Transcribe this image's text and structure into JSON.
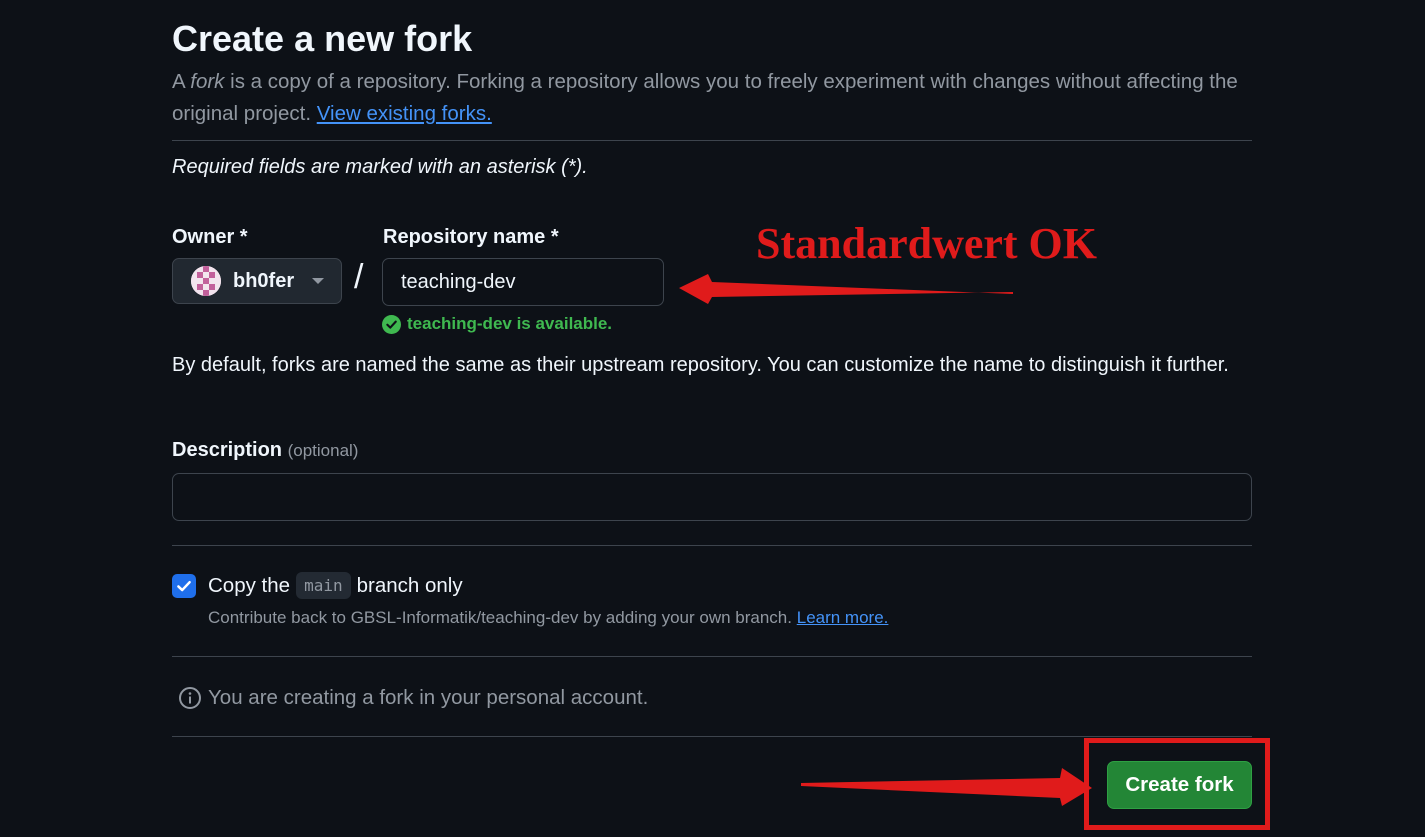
{
  "header": {
    "title": "Create a new fork",
    "subtitle_prefix": "A ",
    "subtitle_em": "fork",
    "subtitle_rest": " is a copy of a repository. Forking a repository allows you to freely experiment with changes without affecting the original project. ",
    "view_forks_link": "View existing forks."
  },
  "form": {
    "required_note": "Required fields are marked with an asterisk (*).",
    "owner_label": "Owner *",
    "owner_value": "bh0fer",
    "repo_label": "Repository name *",
    "separator": "/",
    "repo_value": "teaching-dev",
    "availability": "teaching-dev is available.",
    "naming_hint": "By default, forks are named the same as their upstream repository. You can customize the name to distinguish it further.",
    "description_label": "Description",
    "description_optional": "(optional)",
    "description_value": "",
    "copy_branch_before": "Copy the",
    "copy_branch_code": "main",
    "copy_branch_after": "branch only",
    "copy_branch_checked": true,
    "copy_hint": "Contribute back to GBSL-Informatik/teaching-dev by adding your own branch.",
    "learn_more": "Learn more.",
    "info_text": "You are creating a fork in your personal account.",
    "create_button": "Create fork"
  },
  "annotations": {
    "text": "Standardwert OK",
    "color": "#e01b1b"
  },
  "icons": {
    "owner_caret": "triangle-down-icon",
    "availability": "check-circle-icon",
    "checkbox": "check-icon",
    "info": "info-icon"
  },
  "colors": {
    "background": "#0d1117",
    "accent_link": "#4493f8",
    "success": "#3fb950",
    "primary_button": "#238636",
    "checkbox": "#1f6feb"
  }
}
